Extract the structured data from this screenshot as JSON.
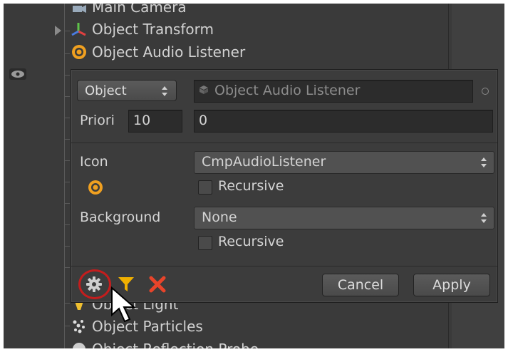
{
  "tree": {
    "items": [
      {
        "label": "Main Camera",
        "icon": "camera-icon"
      },
      {
        "label": "Object Transform",
        "icon": "transform-icon"
      },
      {
        "label": "Object Audio Listener",
        "icon": "audio-listener-icon"
      },
      {
        "label": "Object Light",
        "icon": "light-icon"
      },
      {
        "label": "Object Particles",
        "icon": "particles-icon"
      },
      {
        "label": "Object Reflection Probe",
        "icon": "reflection-probe-icon"
      }
    ]
  },
  "popup": {
    "type_select": "Object",
    "object_field": "Object Audio Listener",
    "priority_label": "Priori",
    "priority_value": "10",
    "priority_field": "0",
    "icon_label": "Icon",
    "icon_select": "CmpAudioListener",
    "icon_recursive": "Recursive",
    "background_label": "Background",
    "background_select": "None",
    "background_recursive": "Recursive",
    "cancel_label": "Cancel",
    "apply_label": "Apply"
  },
  "colors": {
    "highlight_ring": "#c41d1d",
    "filter_icon": "#f0b000",
    "delete_icon": "#e8442a",
    "audio_icon": "#f0a020"
  }
}
